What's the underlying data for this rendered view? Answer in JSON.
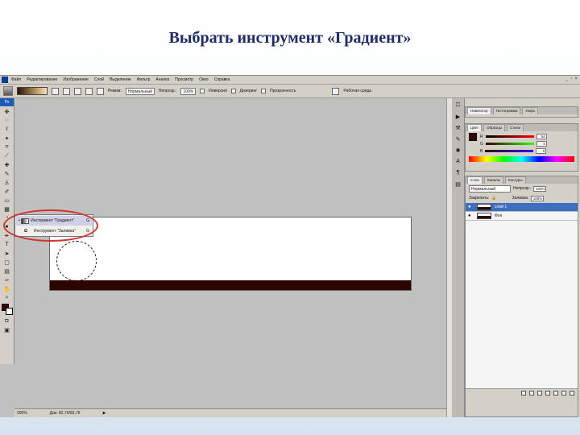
{
  "slide": {
    "title": "Выбрать инструмент «Градиент»"
  },
  "menubar": {
    "items": [
      "Файл",
      "Редактирование",
      "Изображение",
      "Слой",
      "Выделение",
      "Фильтр",
      "Анализ",
      "Просмотр",
      "Окно",
      "Справка"
    ]
  },
  "options_bar": {
    "mode_label": "Режим:",
    "mode_value": "Нормальный",
    "opacity_label": "Непрозр.:",
    "opacity_value": "100%",
    "reverse_label": "Инверсия",
    "dither_label": "Дизеринг",
    "transparency_label": "Прозрачность",
    "workspace_label": "Рабочая среда"
  },
  "toolbox": {
    "header": "Ps"
  },
  "flyout": {
    "items": [
      {
        "label": "Инструмент \"Градиент\"",
        "key": "G"
      },
      {
        "label": "Инструмент \"Заливка\"",
        "key": "G"
      }
    ]
  },
  "status": {
    "zoom": "200%",
    "doc": "Док: 82,7К/82,7К"
  },
  "panels": {
    "top_tabs": [
      "Навигатор",
      "Гистограмма",
      "Инфо"
    ],
    "color_tabs": [
      "Цвет",
      "Образцы",
      "Стили"
    ],
    "color_rows": [
      {
        "label": "R",
        "value": "54"
      },
      {
        "label": "G",
        "value": "5"
      },
      {
        "label": "B",
        "value": "0"
      }
    ],
    "layers_tabs": [
      "Слои",
      "Каналы",
      "Контуры"
    ],
    "blend_mode": "Нормальный",
    "opacity_label": "Непрозр.:",
    "opacity_value": "100%",
    "lock_label": "Закрепить:",
    "fill_label": "Заливка:",
    "fill_value": "100%",
    "layers": [
      {
        "name": "слой 1",
        "selected": true
      },
      {
        "name": "Фон",
        "selected": false
      }
    ]
  },
  "colors": {
    "foreground": "#3a0500",
    "background": "#ffffff",
    "highlight": "#d0342c"
  }
}
